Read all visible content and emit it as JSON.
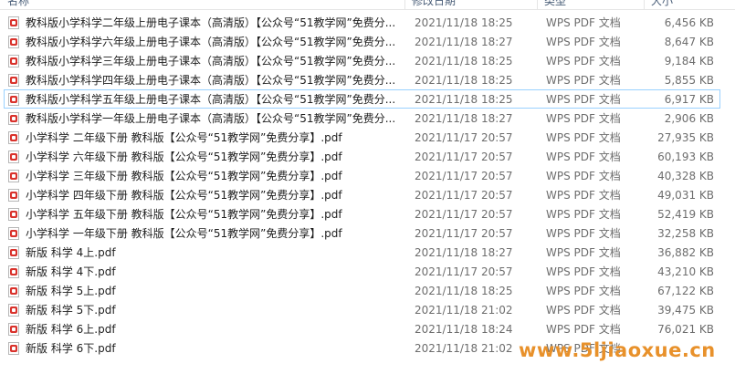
{
  "header": {
    "name": "名称",
    "date": "修改日期",
    "type": "类型",
    "size": "大小"
  },
  "files": [
    {
      "name": "教科版小学科学二年级上册电子课本（高清版）【公众号“51教学网”免费分...",
      "date": "2021/11/18 18:25",
      "type": "WPS PDF 文档",
      "size": "6,456 KB"
    },
    {
      "name": "教科版小学科学六年级上册电子课本（高清版）【公众号“51教学网”免费分...",
      "date": "2021/11/18 18:27",
      "type": "WPS PDF 文档",
      "size": "8,647 KB"
    },
    {
      "name": "教科版小学科学三年级上册电子课本（高清版）【公众号“51教学网”免费分...",
      "date": "2021/11/18 18:25",
      "type": "WPS PDF 文档",
      "size": "9,184 KB"
    },
    {
      "name": "教科版小学科学四年级上册电子课本（高清版）【公众号“51教学网”免费分...",
      "date": "2021/11/18 18:25",
      "type": "WPS PDF 文档",
      "size": "5,855 KB"
    },
    {
      "name": "教科版小学科学五年级上册电子课本（高清版）【公众号“51教学网”免费分...",
      "date": "2021/11/18 18:25",
      "type": "WPS PDF 文档",
      "size": "6,917 KB"
    },
    {
      "name": "教科版小学科学一年级上册电子课本（高清版）【公众号“51教学网”免费分...",
      "date": "2021/11/18 18:27",
      "type": "WPS PDF 文档",
      "size": "2,906 KB"
    },
    {
      "name": "小学科学 二年级下册 教科版【公众号“51教学网”免费分享】.pdf",
      "date": "2021/11/17 20:57",
      "type": "WPS PDF 文档",
      "size": "27,935 KB"
    },
    {
      "name": "小学科学 六年级下册 教科版【公众号“51教学网”免费分享】.pdf",
      "date": "2021/11/17 20:57",
      "type": "WPS PDF 文档",
      "size": "60,193 KB"
    },
    {
      "name": "小学科学 三年级下册 教科版【公众号“51教学网”免费分享】.pdf",
      "date": "2021/11/17 20:57",
      "type": "WPS PDF 文档",
      "size": "40,328 KB"
    },
    {
      "name": "小学科学 四年级下册 教科版【公众号“51教学网”免费分享】.pdf",
      "date": "2021/11/17 20:57",
      "type": "WPS PDF 文档",
      "size": "49,031 KB"
    },
    {
      "name": "小学科学 五年级下册 教科版【公众号“51教学网”免费分享】.pdf",
      "date": "2021/11/17 20:57",
      "type": "WPS PDF 文档",
      "size": "52,419 KB"
    },
    {
      "name": "小学科学 一年级下册 教科版【公众号“51教学网”免费分享】.pdf",
      "date": "2021/11/17 20:57",
      "type": "WPS PDF 文档",
      "size": "32,258 KB"
    },
    {
      "name": "新版  科学 4上.pdf",
      "date": "2021/11/18 18:27",
      "type": "WPS PDF 文档",
      "size": "36,882 KB"
    },
    {
      "name": "新版  科学 4下.pdf",
      "date": "2021/11/17 20:57",
      "type": "WPS PDF 文档",
      "size": "43,210 KB"
    },
    {
      "name": "新版  科学 5上.pdf",
      "date": "2021/11/18 18:25",
      "type": "WPS PDF 文档",
      "size": "67,122 KB"
    },
    {
      "name": "新版  科学 5下.pdf",
      "date": "2021/11/18 21:02",
      "type": "WPS PDF 文档",
      "size": "39,475 KB"
    },
    {
      "name": "新版  科学 6上.pdf",
      "date": "2021/11/18 18:24",
      "type": "WPS PDF 文档",
      "size": "76,021 KB"
    },
    {
      "name": "新版  科学 6下.pdf",
      "date": "2021/11/18 21:02",
      "type": "WPS PDF 文档",
      "size": ""
    }
  ],
  "selected_index": 4,
  "watermark": "www.5ljiaoxue.cn",
  "colors": {
    "selection_border": "#99d1ff",
    "pdf_icon_red": "#d9322c",
    "watermark": "#e8912b"
  },
  "icon": "pdf-file-icon"
}
